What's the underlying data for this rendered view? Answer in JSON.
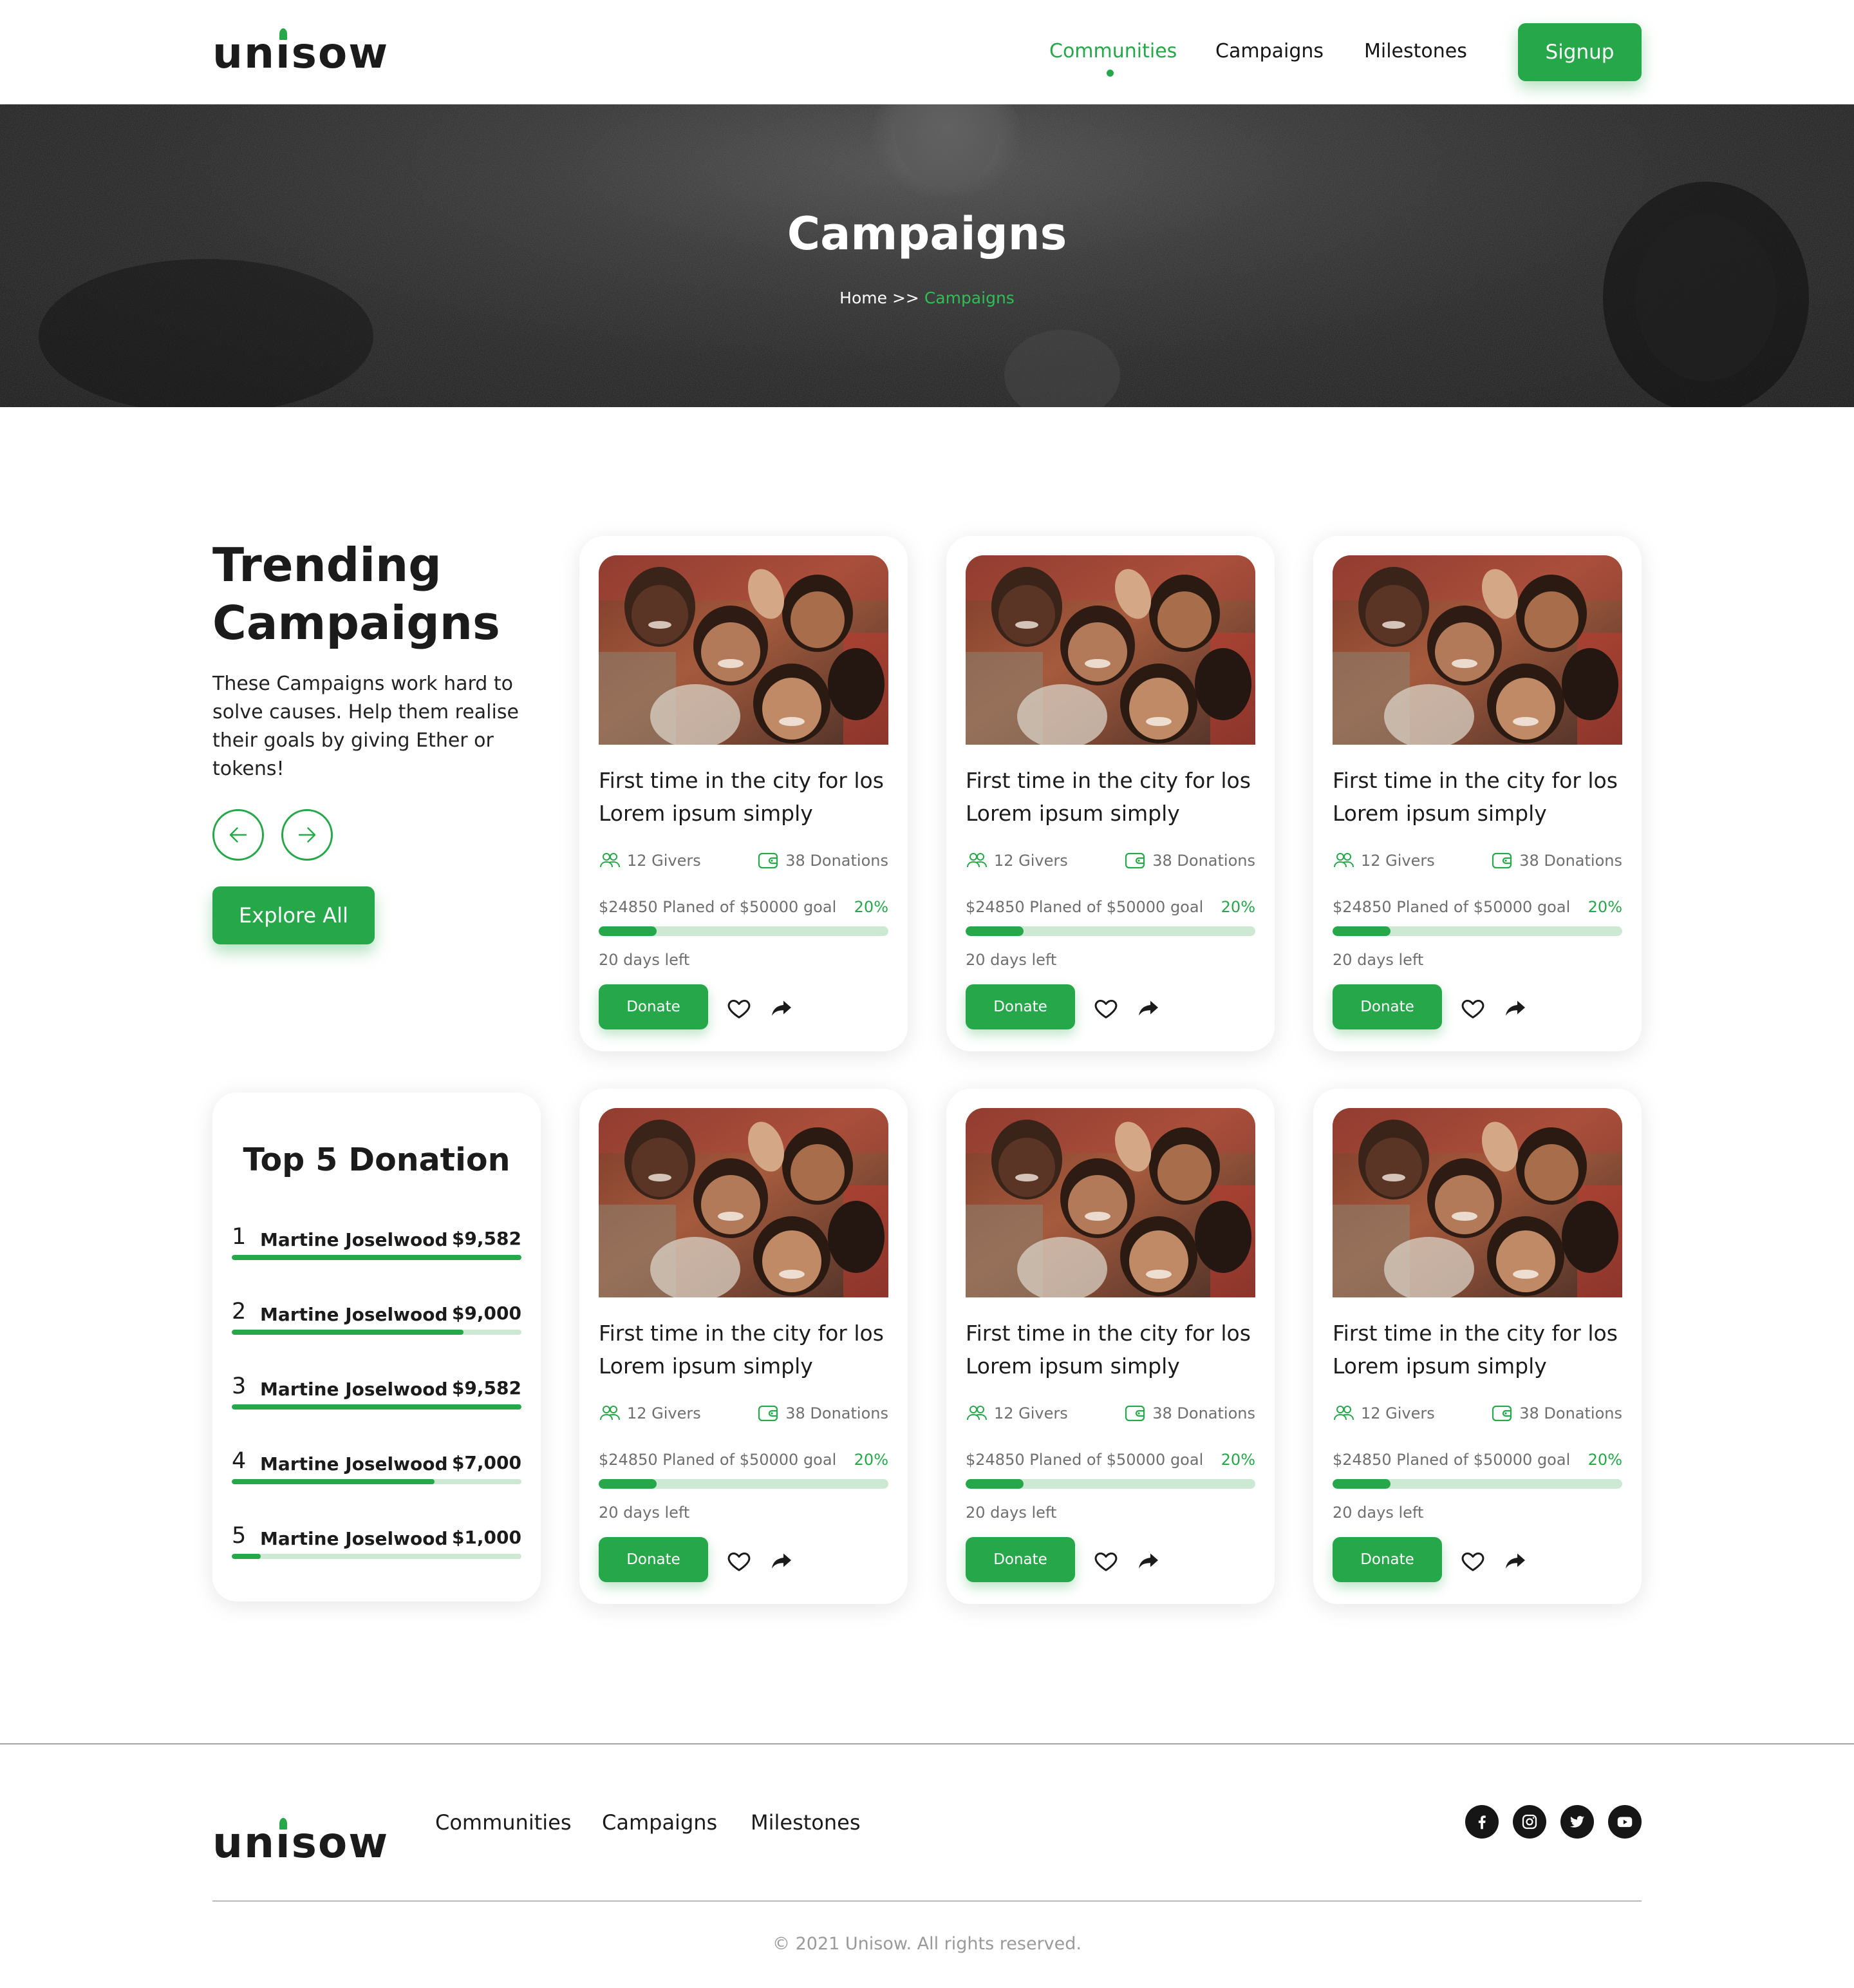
{
  "brand": {
    "name": "unisow",
    "accent_color": "#26a74a",
    "text_color": "#1b1b1b"
  },
  "nav": {
    "items": [
      {
        "label": "Communities",
        "active": true
      },
      {
        "label": "Campaigns",
        "active": false
      },
      {
        "label": "Milestones",
        "active": false
      }
    ],
    "signup_label": "Signup"
  },
  "hero": {
    "title": "Campaigns",
    "breadcrumb": {
      "home": "Home",
      "separator": ">>",
      "current": "Campaigns"
    }
  },
  "trending": {
    "title": "Trending Campaigns",
    "description": "These Campaigns work hard to solve causes. Help them realise their goals by giving Ether or tokens!",
    "prev_icon": "arrow-left-icon",
    "next_icon": "arrow-right-icon",
    "explore_label": "Explore All"
  },
  "cards": [
    {
      "title": "First time in the city for los Lorem ipsum simply",
      "givers": "12 Givers",
      "donations": "38 Donations",
      "planned": "$24850 Planed of $50000 goal",
      "percent": "20%",
      "progress": 0.2,
      "days_left": "20 days left",
      "donate_label": "Donate"
    },
    {
      "title": "First time in the city for los Lorem ipsum simply",
      "givers": "12 Givers",
      "donations": "38 Donations",
      "planned": "$24850 Planed of $50000 goal",
      "percent": "20%",
      "progress": 0.2,
      "days_left": "20 days left",
      "donate_label": "Donate"
    },
    {
      "title": "First time in the city for los Lorem ipsum simply",
      "givers": "12 Givers",
      "donations": "38 Donations",
      "planned": "$24850 Planed of $50000 goal",
      "percent": "20%",
      "progress": 0.2,
      "days_left": "20 days left",
      "donate_label": "Donate"
    },
    {
      "title": "First time in the city for los Lorem ipsum simply",
      "givers": "12 Givers",
      "donations": "38 Donations",
      "planned": "$24850 Planed of $50000 goal",
      "percent": "20%",
      "progress": 0.2,
      "days_left": "20 days left",
      "donate_label": "Donate"
    },
    {
      "title": "First time in the city for los Lorem ipsum simply",
      "givers": "12 Givers",
      "donations": "38 Donations",
      "planned": "$24850 Planed of $50000 goal",
      "percent": "20%",
      "progress": 0.2,
      "days_left": "20 days left",
      "donate_label": "Donate"
    },
    {
      "title": "First time in the city for los Lorem ipsum simply",
      "givers": "12 Givers",
      "donations": "38 Donations",
      "planned": "$24850 Planed of $50000 goal",
      "percent": "20%",
      "progress": 0.2,
      "days_left": "20 days left",
      "donate_label": "Donate"
    }
  ],
  "top5": {
    "title": "Top 5 Donation",
    "donors": [
      {
        "rank": "1",
        "name": "Martine Joselwood",
        "amount": "$9,582",
        "level": 1.0
      },
      {
        "rank": "2",
        "name": "Martine Joselwood",
        "amount": "$9,000",
        "level": 0.8
      },
      {
        "rank": "3",
        "name": "Martine Joselwood",
        "amount": "$9,582",
        "level": 1.0
      },
      {
        "rank": "4",
        "name": "Martine Joselwood",
        "amount": "$7,000",
        "level": 0.7
      },
      {
        "rank": "5",
        "name": "Martine Joselwood",
        "amount": "$1,000",
        "level": 0.1
      }
    ]
  },
  "footer": {
    "links": [
      "Communities",
      "Campaigns",
      "Milestones"
    ],
    "social_icons": [
      "facebook-icon",
      "instagram-icon",
      "twitter-icon",
      "youtube-icon"
    ],
    "copyright": "© 2021 Unisow. All rights reserved."
  }
}
